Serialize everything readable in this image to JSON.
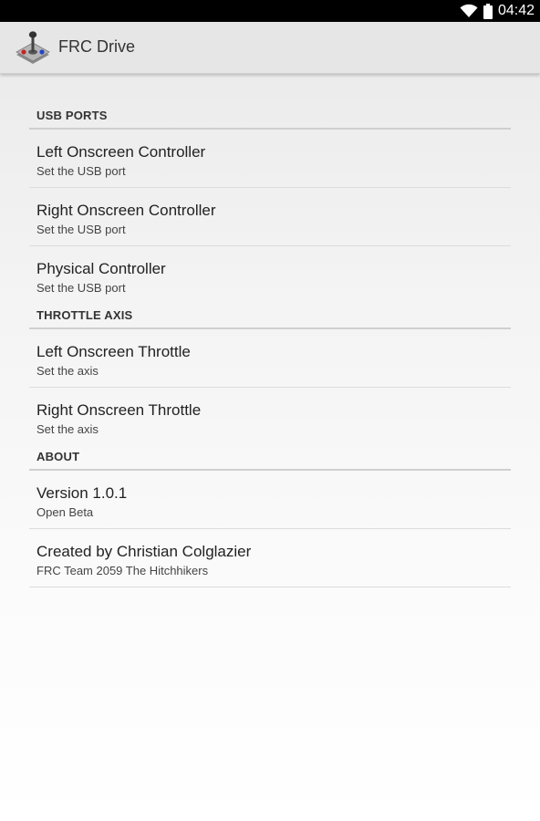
{
  "status_bar": {
    "time": "04:42",
    "icons": [
      "wifi-icon",
      "battery-icon"
    ]
  },
  "action_bar": {
    "title": "FRC Drive",
    "icon": "joystick-app-icon"
  },
  "sections": [
    {
      "title": "USB PORTS",
      "items": [
        {
          "title": "Left Onscreen Controller",
          "summary": "Set the USB port"
        },
        {
          "title": "Right Onscreen Controller",
          "summary": "Set the USB port"
        },
        {
          "title": "Physical Controller",
          "summary": "Set the USB port"
        }
      ]
    },
    {
      "title": "THROTTLE AXIS",
      "items": [
        {
          "title": "Left Onscreen Throttle",
          "summary": "Set the axis"
        },
        {
          "title": "Right Onscreen Throttle",
          "summary": "Set the axis"
        }
      ]
    },
    {
      "title": "ABOUT",
      "items": [
        {
          "title": "Version 1.0.1",
          "summary": "Open Beta"
        },
        {
          "title": "Created by Christian Colglazier",
          "summary": "FRC Team 2059 The Hitchhikers"
        }
      ]
    }
  ],
  "colors": {
    "status_bar": "#000000",
    "action_bar": "#e6e6e6",
    "divider": "#cfcfcf",
    "joystick_red": "#cc2222",
    "joystick_blue": "#2244cc"
  }
}
